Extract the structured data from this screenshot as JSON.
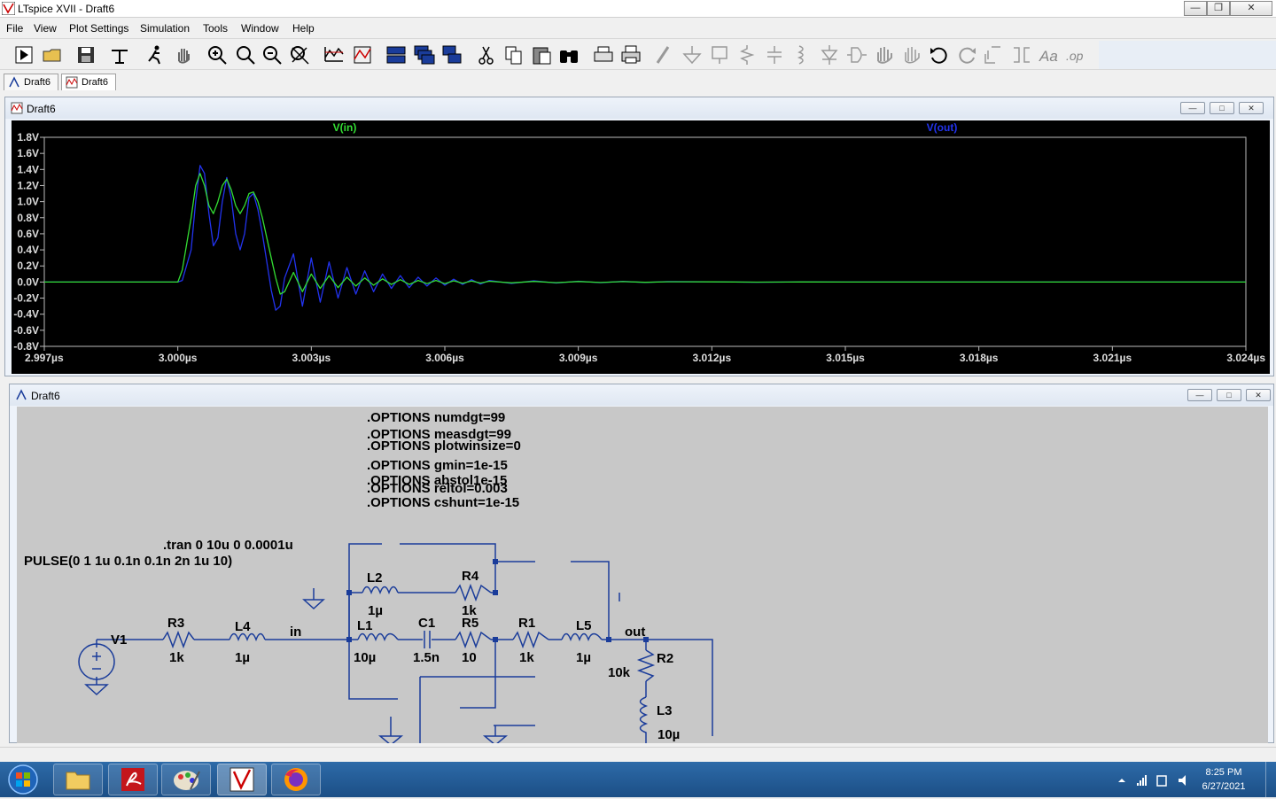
{
  "window": {
    "title": "LTspice XVII - Draft6",
    "controls": [
      "minimize",
      "restore",
      "close"
    ]
  },
  "menu": [
    "File",
    "View",
    "Plot Settings",
    "Simulation",
    "Tools",
    "Window",
    "Help"
  ],
  "toolbar_icons": [
    "run-icon",
    "open-icon",
    "save-icon",
    "control-panel-icon",
    "halt-icon",
    "pan-icon",
    "zoom-in-icon",
    "zoom-area-icon",
    "zoom-out-icon",
    "zoom-fit-icon",
    "autorange-icon",
    "mark-icon",
    "tile-horizontal-icon",
    "cascade-icon",
    "tile-vertical-icon",
    "cut-icon",
    "copy-icon",
    "paste-icon",
    "find-icon",
    "print-setup-icon",
    "print-icon",
    "wire-icon",
    "ground-icon",
    "label-icon",
    "resistor-icon",
    "capacitor-icon",
    "inductor-icon",
    "diode-icon",
    "component-icon",
    "move-icon",
    "drag-icon",
    "undo-icon",
    "redo-icon",
    "rotate-icon",
    "mirror-icon",
    "text-icon",
    "spice-directive-icon"
  ],
  "tabs": [
    {
      "label": "Draft6",
      "icon": "schematic-icon"
    },
    {
      "label": "Draft6",
      "icon": "waveform-icon"
    }
  ],
  "plot_window": {
    "title": "Draft6"
  },
  "schematic_window": {
    "title": "Draft6"
  },
  "chart_data": {
    "type": "line",
    "title": "",
    "xlabel": "",
    "ylabel": "",
    "xlim": [
      2.997,
      3.024
    ],
    "ylim": [
      -0.8,
      1.8
    ],
    "x_unit": "µs",
    "y_unit": "V",
    "x_ticks": [
      "2.997µs",
      "3.000µs",
      "3.003µs",
      "3.006µs",
      "3.009µs",
      "3.012µs",
      "3.015µs",
      "3.018µs",
      "3.021µs",
      "3.024µs"
    ],
    "y_ticks": [
      "1.8V",
      "1.6V",
      "1.4V",
      "1.2V",
      "1.0V",
      "0.8V",
      "0.6V",
      "0.4V",
      "0.2V",
      "0.0V",
      "-0.2V",
      "-0.4V",
      "-0.6V",
      "-0.8V"
    ],
    "grid": false,
    "legend": "top",
    "background": "#000000",
    "series": [
      {
        "name": "V(in)",
        "color": "#33dd33",
        "x": [
          2.997,
          3.0,
          3.0001,
          3.0003,
          3.0004,
          3.0005,
          3.0006,
          3.0007,
          3.0008,
          3.0009,
          3.001,
          3.0011,
          3.0012,
          3.0013,
          3.0014,
          3.0015,
          3.0016,
          3.0017,
          3.0018,
          3.0019,
          3.002,
          3.0021,
          3.0022,
          3.0023,
          3.0024,
          3.0026,
          3.0028,
          3.003,
          3.0032,
          3.0034,
          3.0036,
          3.0038,
          3.004,
          3.0042,
          3.0044,
          3.0046,
          3.0048,
          3.005,
          3.0052,
          3.0054,
          3.0056,
          3.0058,
          3.006,
          3.0062,
          3.0064,
          3.0066,
          3.0068,
          3.007,
          3.0075,
          3.008,
          3.0085,
          3.009,
          3.0095,
          3.01,
          3.0105,
          3.011,
          3.012,
          3.013,
          3.014,
          3.015,
          3.016,
          3.024
        ],
        "values": [
          0.0,
          0.0,
          0.15,
          0.8,
          1.2,
          1.35,
          1.2,
          0.95,
          0.85,
          1.0,
          1.2,
          1.28,
          1.15,
          0.95,
          0.85,
          0.95,
          1.1,
          1.12,
          1.0,
          0.8,
          0.55,
          0.3,
          0.05,
          -0.15,
          -0.12,
          0.12,
          -0.12,
          0.1,
          -0.08,
          0.08,
          -0.07,
          0.06,
          -0.05,
          0.05,
          -0.04,
          0.04,
          -0.03,
          0.03,
          -0.03,
          0.02,
          -0.02,
          0.02,
          -0.02,
          0.015,
          -0.015,
          0.012,
          -0.012,
          0.01,
          -0.01,
          0.008,
          -0.008,
          0.006,
          -0.006,
          0.005,
          -0.004,
          0.003,
          0.002,
          -0.001,
          0.001,
          0.0,
          0.0,
          0.0
        ]
      },
      {
        "name": "V(out)",
        "color": "#2233ee",
        "x": [
          2.997,
          3.0,
          3.0001,
          3.0003,
          3.0004,
          3.0005,
          3.0006,
          3.0007,
          3.0008,
          3.0009,
          3.001,
          3.0011,
          3.0012,
          3.0013,
          3.0014,
          3.0015,
          3.0016,
          3.0017,
          3.0018,
          3.0019,
          3.002,
          3.0021,
          3.0022,
          3.0023,
          3.0024,
          3.0026,
          3.0028,
          3.003,
          3.0032,
          3.0034,
          3.0036,
          3.0038,
          3.004,
          3.0042,
          3.0044,
          3.0046,
          3.0048,
          3.005,
          3.0052,
          3.0054,
          3.0056,
          3.0058,
          3.006,
          3.0062,
          3.0064,
          3.0066,
          3.0068,
          3.007,
          3.0075,
          3.008,
          3.0085,
          3.009,
          3.0095,
          3.01,
          3.0105,
          3.011,
          3.012,
          3.013,
          3.014,
          3.015,
          3.016,
          3.024
        ],
        "values": [
          0.0,
          0.0,
          0.02,
          0.4,
          1.0,
          1.45,
          1.35,
          0.85,
          0.45,
          0.55,
          1.0,
          1.3,
          1.05,
          0.6,
          0.4,
          0.6,
          1.05,
          1.1,
          0.9,
          0.6,
          0.25,
          -0.1,
          -0.35,
          -0.3,
          0.05,
          0.35,
          -0.3,
          0.3,
          -0.25,
          0.25,
          -0.2,
          0.18,
          -0.15,
          0.14,
          -0.12,
          0.1,
          -0.08,
          0.08,
          -0.07,
          0.06,
          -0.05,
          0.05,
          -0.04,
          0.035,
          -0.03,
          0.03,
          -0.025,
          0.02,
          -0.018,
          0.015,
          -0.012,
          0.01,
          -0.008,
          0.007,
          -0.006,
          0.005,
          0.003,
          -0.002,
          0.001,
          0.0,
          0.0,
          0.0
        ]
      }
    ]
  },
  "schematic": {
    "directives": [
      ".OPTIONS numdgt=99",
      ".OPTIONS measdgt=99",
      ".OPTIONS plotwinsize=0",
      ".OPTIONS gmin=1e-15",
      ".OPTIONS abstol1e-15",
      ".OPTIONS reltol=0.003",
      ".OPTIONS cshunt=1e-15"
    ],
    "tran": ".tran 0 10u 0 0.0001u",
    "pulse": "PULSE(0 1 1u 0.1n 0.1n 2n 1u 10)",
    "labels": {
      "V1": "V1",
      "R3": "R3",
      "R3v": "1k",
      "L4": "L4",
      "L4v": "1µ",
      "in": "in",
      "L1": "L1",
      "L1v": "10µ",
      "C1": "C1",
      "C1v": "1.5n",
      "R5": "R5",
      "R5v": "10",
      "L2": "L2",
      "L2v": "1µ",
      "R4": "R4",
      "R4v": "1k",
      "R1": "R1",
      "R1v": "1k",
      "L5": "L5",
      "L5v": "1µ",
      "out": "out",
      "R2": "R2",
      "R2v": "10k",
      "L3": "L3",
      "L3v": "10µ"
    }
  },
  "clock": {
    "time": "8:25 PM",
    "date": "6/27/2021"
  },
  "taskbar_apps": [
    "start-orb-icon",
    "file-explorer-icon",
    "acrobat-icon",
    "paint-icon",
    "ltspice-icon",
    "firefox-icon"
  ]
}
